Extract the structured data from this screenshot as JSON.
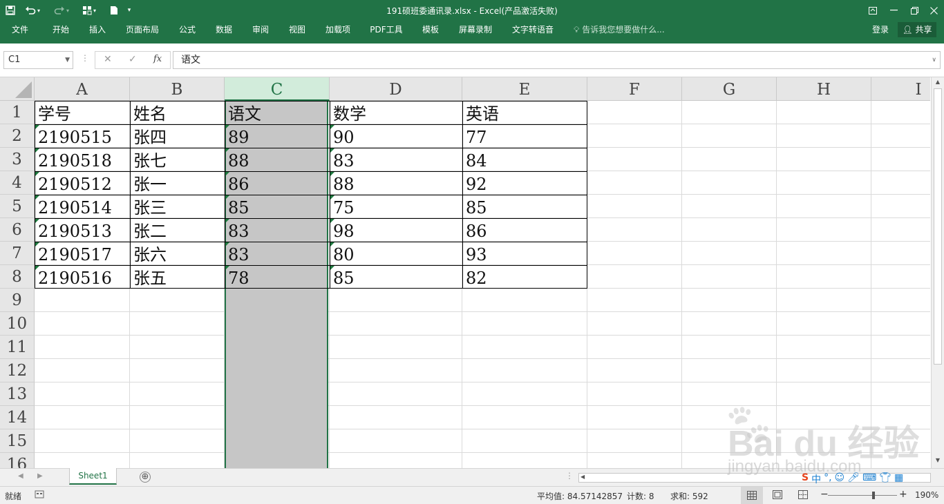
{
  "window": {
    "title": "191硕班委通讯录.xlsx - Excel(产品激活失败)",
    "quick_access": {
      "save_icon": "save-icon",
      "undo_icon": "undo-icon",
      "redo_icon": "redo-icon",
      "customize": "▾"
    }
  },
  "ribbon": {
    "tabs": [
      "文件",
      "开始",
      "插入",
      "页面布局",
      "公式",
      "数据",
      "审阅",
      "视图",
      "加载项",
      "PDF工具",
      "模板",
      "屏幕录制",
      "文字转语音"
    ],
    "tell_me": "告诉我您想要做什么...",
    "login": "登录",
    "share": "共享"
  },
  "formula_bar": {
    "name_box": "C1",
    "cancel": "✕",
    "enter": "✓",
    "fx": "fx",
    "content": "语文"
  },
  "sheet": {
    "columns": [
      "A",
      "B",
      "C",
      "D",
      "E",
      "F",
      "G",
      "H",
      "I"
    ],
    "selected_column": "C",
    "rows": [
      "1",
      "2",
      "3",
      "4",
      "5",
      "6",
      "7",
      "8",
      "9",
      "10",
      "11",
      "12",
      "13",
      "14",
      "15",
      "16"
    ],
    "data": [
      [
        "学号",
        "姓名",
        "语文",
        "数学",
        "英语"
      ],
      [
        "2190515",
        "张四",
        "89",
        "90",
        "77"
      ],
      [
        "2190518",
        "张七",
        "88",
        "83",
        "84"
      ],
      [
        "2190512",
        "张一",
        "86",
        "88",
        "92"
      ],
      [
        "2190514",
        "张三",
        "85",
        "75",
        "85"
      ],
      [
        "2190513",
        "张二",
        "83",
        "98",
        "86"
      ],
      [
        "2190517",
        "张六",
        "83",
        "80",
        "93"
      ],
      [
        "2190516",
        "张五",
        "78",
        "85",
        "82"
      ]
    ]
  },
  "sheet_tabs": {
    "active": "Sheet1",
    "add": "⊕"
  },
  "status_bar": {
    "ready": "就绪",
    "average": "平均值: 84.57142857",
    "count": "计数: 8",
    "sum": "求和: 592",
    "zoom": "190%"
  },
  "watermark": {
    "brand": "Bai du 经验",
    "url": "jingyan.baidu.com"
  }
}
